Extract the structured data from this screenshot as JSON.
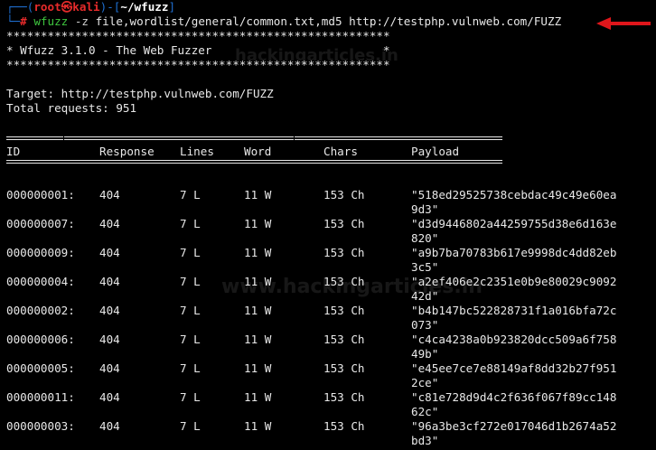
{
  "prompt": {
    "top_open": "┌──(",
    "user_host": "root㉿kali",
    "mid": ")-[",
    "cwd": "~/wfuzz",
    "top_close": "]",
    "bottom_prefix": "└─",
    "hash": "# ",
    "command": "wfuzz",
    "flag": " -z",
    "args": " file,wordlist/general/common.txt,md5 http://testphp.vulnweb.com/FUZZ"
  },
  "banner": {
    "stars": "********************************************************",
    "title_line": "* Wfuzz 3.1.0 - The Web Fuzzer                         *"
  },
  "target_line": "Target: http://testphp.vulnweb.com/FUZZ",
  "total_line": "Total requests: 951",
  "headers": {
    "id": "ID",
    "response": "Response",
    "lines": "Lines",
    "word": "Word",
    "chars": "Chars",
    "payload": "Payload"
  },
  "rows": [
    {
      "id": "000000001:",
      "response": "404",
      "lines": "7 L",
      "word": "11 W",
      "chars": "153 Ch",
      "payload1": "\"518ed29525738cebdac49c49e60ea",
      "payload2": "9d3\""
    },
    {
      "id": "000000007:",
      "response": "404",
      "lines": "7 L",
      "word": "11 W",
      "chars": "153 Ch",
      "payload1": "\"d3d9446802a44259755d38e6d163e",
      "payload2": "820\""
    },
    {
      "id": "000000009:",
      "response": "404",
      "lines": "7 L",
      "word": "11 W",
      "chars": "153 Ch",
      "payload1": "\"a9b7ba70783b617e9998dc4dd82eb",
      "payload2": "3c5\""
    },
    {
      "id": "000000004:",
      "response": "404",
      "lines": "7 L",
      "word": "11 W",
      "chars": "153 Ch",
      "payload1": "\"a2ef406e2c2351e0b9e80029c9092",
      "payload2": "42d\""
    },
    {
      "id": "000000002:",
      "response": "404",
      "lines": "7 L",
      "word": "11 W",
      "chars": "153 Ch",
      "payload1": "\"b4b147bc522828731f1a016bfa72c",
      "payload2": "073\""
    },
    {
      "id": "000000006:",
      "response": "404",
      "lines": "7 L",
      "word": "11 W",
      "chars": "153 Ch",
      "payload1": "\"c4ca4238a0b923820dcc509a6f758",
      "payload2": "49b\""
    },
    {
      "id": "000000005:",
      "response": "404",
      "lines": "7 L",
      "word": "11 W",
      "chars": "153 Ch",
      "payload1": "\"e45ee7ce7e88149af8dd32b27f951",
      "payload2": "2ce\""
    },
    {
      "id": "000000011:",
      "response": "404",
      "lines": "7 L",
      "word": "11 W",
      "chars": "153 Ch",
      "payload1": "\"c81e728d9d4c2f636f067f89cc148",
      "payload2": "62c\""
    },
    {
      "id": "000000003:",
      "response": "404",
      "lines": "7 L",
      "word": "11 W",
      "chars": "153 Ch",
      "payload1": "\"96a3be3cf272e017046d1b2674a52",
      "payload2": "bd3\""
    }
  ],
  "watermark": {
    "top": "hackingarticles.in",
    "mid": "www.hackingarticles.in"
  },
  "colors": {
    "background": "#000000",
    "arrow": "#e0161b",
    "prompt_blue": "#1f6fd1",
    "prompt_red": "#e82b2b",
    "command_green": "#3ec63e"
  },
  "icons": {
    "arrow": "red-left-arrow-icon"
  }
}
